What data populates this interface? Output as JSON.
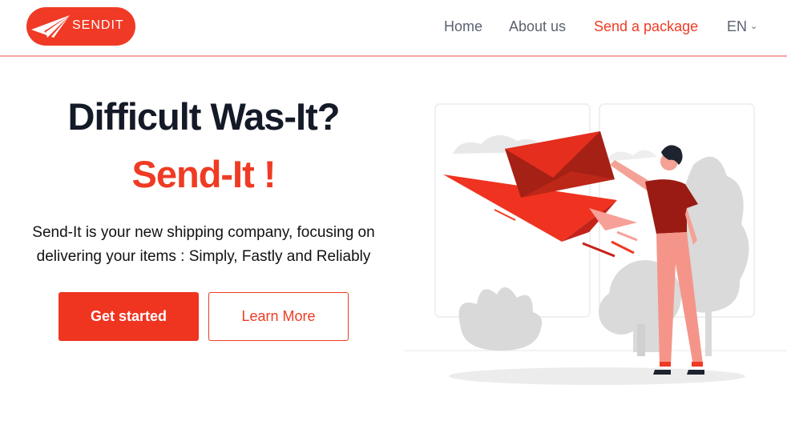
{
  "navbar": {
    "logo_text": "SENDIT",
    "links": [
      {
        "label": "Home",
        "active": false
      },
      {
        "label": "About us",
        "active": false
      },
      {
        "label": "Send a package",
        "active": true
      }
    ],
    "language": "EN"
  },
  "hero": {
    "title": "Difficult Was-It?",
    "subtitle": "Send-It !",
    "description": "Send-It is your new shipping company, focusing on delivering your items : Simply, Fastly and Reliably",
    "primary_button": "Get started",
    "secondary_button": "Learn More"
  },
  "colors": {
    "accent": "#ef3b24",
    "title": "#141a27",
    "nav_text": "#5b6270",
    "illustration_gray": "#dadada"
  },
  "icons": {
    "logo": "paper-plane-icon",
    "language_dropdown": "chevron-down-icon"
  }
}
